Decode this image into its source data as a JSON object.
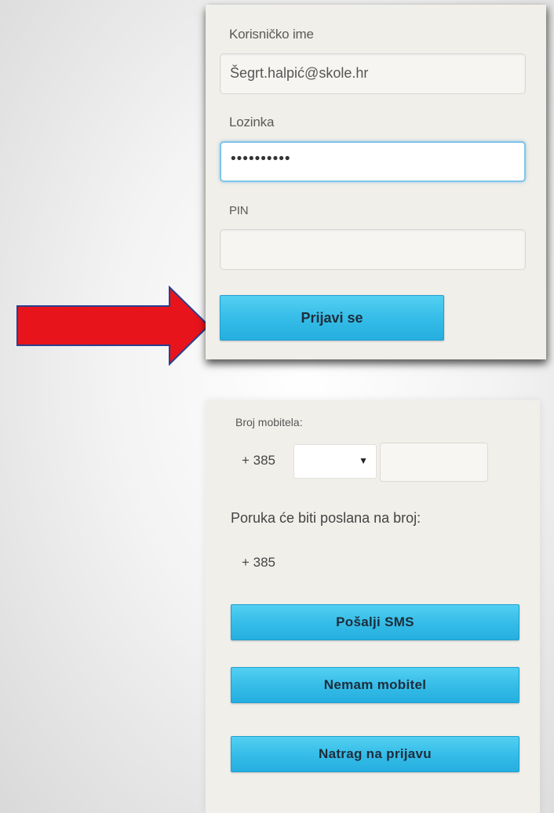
{
  "login_form": {
    "username_label": "Korisničko ime",
    "username_value": "Šegrt.halpić@skole.hr",
    "password_label": "Lozinka",
    "password_value": "••••••••••",
    "pin_label": "PIN",
    "pin_value": "",
    "submit_label": "Prijavi se"
  },
  "sms_form": {
    "mobile_label": "Broj mobitela:",
    "country_prefix": "+ 385",
    "operator_selected": "",
    "phone_value": "",
    "message_info": "Poruka će biti poslana na broj:",
    "target_prefix": "+ 385",
    "send_sms_label": "Pošalji SMS",
    "no_mobile_label": "Nemam mobitel",
    "back_label": "Natrag na prijavu"
  },
  "annotation": {
    "arrow_color": "#e8141b",
    "arrow_outline": "#2b3f8f"
  },
  "colors": {
    "button_blue": "#36bde8",
    "panel_background": "#f1efe9"
  }
}
